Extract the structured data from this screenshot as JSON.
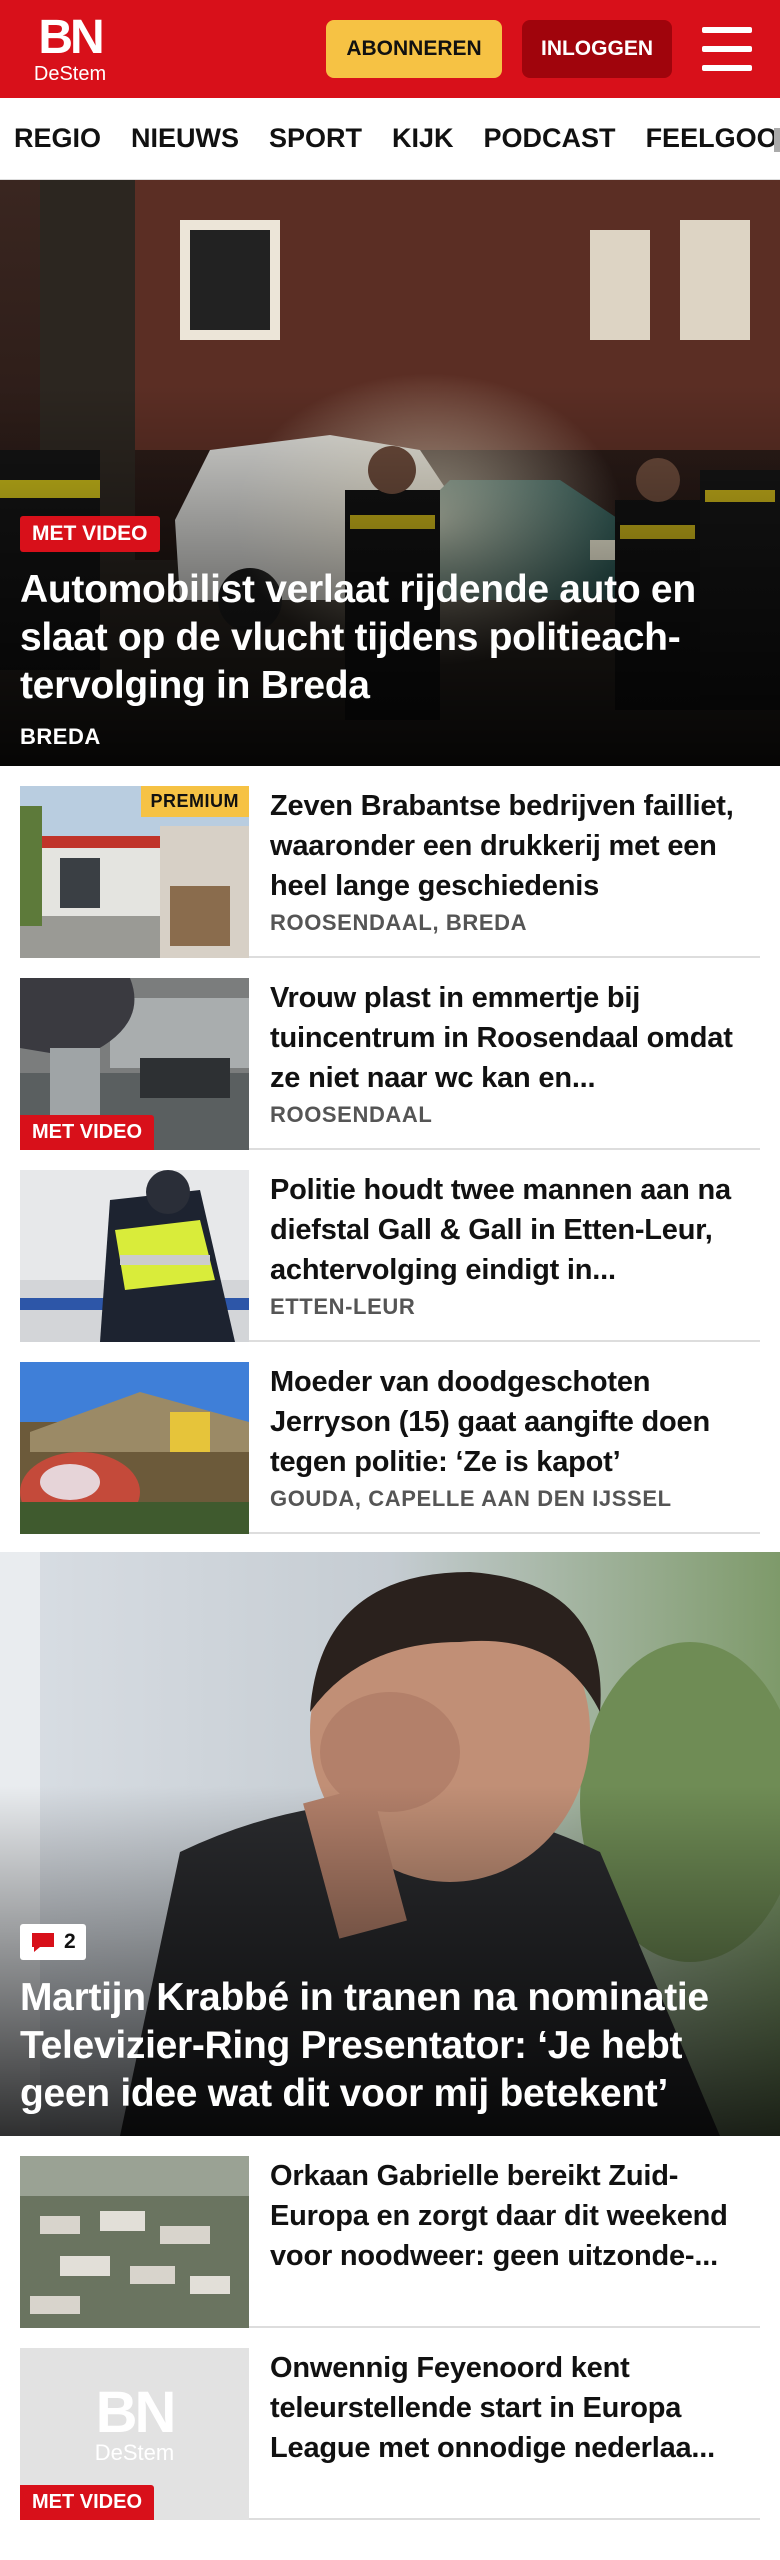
{
  "header": {
    "logo_main": "BN",
    "logo_sub": "DeStem",
    "subscribe_label": "ABONNEREN",
    "login_label": "INLOGGEN"
  },
  "nav": {
    "items": [
      "REGIO",
      "NIEUWS",
      "SPORT",
      "KIJK",
      "PODCAST",
      "FEELGOOD"
    ]
  },
  "hero": {
    "badge": "MET VIDEO",
    "title": "Automobilist verlaat rijdende auto en slaat op de vlucht tijdens politieach-tervolging in Breda",
    "location": "BREDA"
  },
  "articles": [
    {
      "title": "Zeven Brabantse bedrijven failliet, waaronder een drukkerij met een heel lange geschiedenis",
      "location": "ROOSENDAAL, BREDA",
      "premium": "PREMIUM"
    },
    {
      "title": "Vrouw plast in emmertje bij tuincentrum in Roosendaal omdat ze niet naar wc kan en...",
      "location": "ROOSENDAAL",
      "badge": "MET VIDEO"
    },
    {
      "title": "Politie houdt twee mannen aan na diefstal Gall & Gall in Etten-Leur, achtervolging eindigt in...",
      "location": "ETTEN-LEUR"
    },
    {
      "title": "Moeder van doodgeschoten Jerryson (15) gaat aangifte doen tegen politie: ‘Ze is kapot’",
      "location": "GOUDA, CAPELLE AAN DEN IJSSEL"
    }
  ],
  "hero2": {
    "comments": "2",
    "title": "Martijn Krabbé in tranen na nominatie Televizier-Ring Presentator: ‘Je hebt geen idee wat dit voor mij betekent’"
  },
  "articles2": [
    {
      "title": "Orkaan Gabrielle bereikt Zuid-Europa en zorgt daar dit weekend voor noodweer: geen uitzonde-..."
    },
    {
      "title": "Onwennig Feyenoord kent teleurstellende start in Europa League met onnodige nederlaa...",
      "badge": "MET VIDEO",
      "placeholder_logo": "BN",
      "placeholder_sub": "DeStem"
    }
  ],
  "colors": {
    "brand_red": "#d8101a",
    "dark_red": "#a0040c",
    "premium_yellow": "#f6c244"
  }
}
